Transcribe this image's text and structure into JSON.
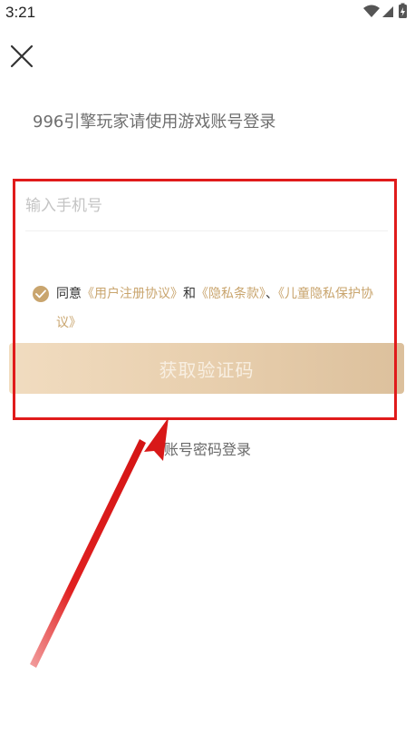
{
  "status_bar": {
    "time": "3:21",
    "icons": [
      "wifi-icon",
      "signal-icon",
      "battery-icon"
    ]
  },
  "header": {
    "close_icon": "close-icon",
    "title": "996引擎玩家请使用游戏账号登录"
  },
  "form": {
    "phone_placeholder": "输入手机号",
    "phone_value": ""
  },
  "agreement": {
    "checked": true,
    "prefix": "同意",
    "user_agreement": "《用户注册协议》",
    "and": "和",
    "privacy_policy": "《隐私条款》",
    "separator": "、",
    "children_privacy": "《儿童隐私保护协议》"
  },
  "actions": {
    "get_code_label": "获取验证码",
    "password_login_label": "账号密码登录"
  },
  "colors": {
    "accent": "#c9a56e",
    "annotation": "#e01b1b",
    "button_gradient_start": "#f1dcc0",
    "button_gradient_end": "#dcc09c"
  }
}
